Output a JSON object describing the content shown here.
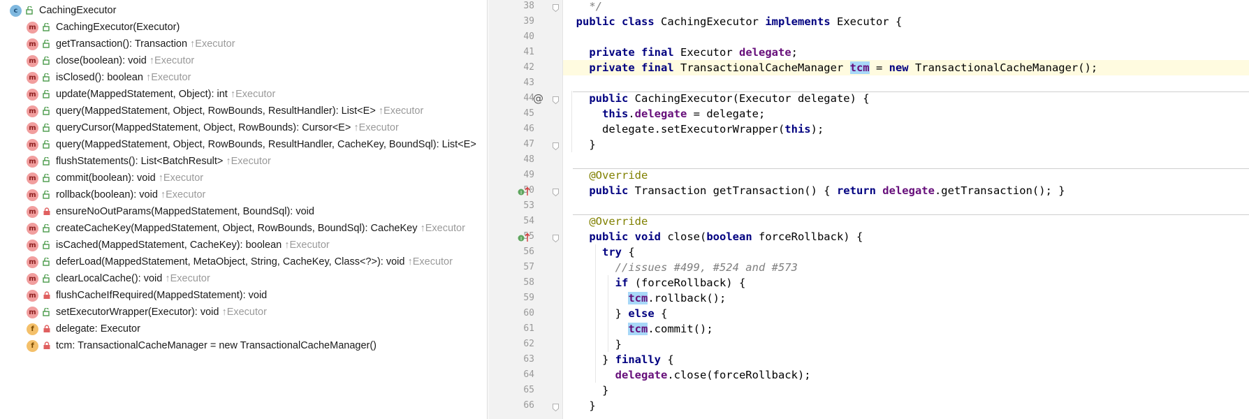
{
  "structure": {
    "root": {
      "label": "CachingExecutor",
      "badge": "c"
    },
    "items": [
      {
        "badge": "m",
        "vis": "public",
        "label": "CachingExecutor(Executor)",
        "inherit": ""
      },
      {
        "badge": "m",
        "vis": "public",
        "label": "getTransaction(): Transaction",
        "inherit": "↑Executor"
      },
      {
        "badge": "m",
        "vis": "public",
        "label": "close(boolean): void",
        "inherit": "↑Executor"
      },
      {
        "badge": "m",
        "vis": "public",
        "label": "isClosed(): boolean",
        "inherit": "↑Executor"
      },
      {
        "badge": "m",
        "vis": "public",
        "label": "update(MappedStatement, Object): int",
        "inherit": "↑Executor"
      },
      {
        "badge": "m",
        "vis": "public",
        "label": "query(MappedStatement, Object, RowBounds, ResultHandler): List<E>",
        "inherit": "↑Executor"
      },
      {
        "badge": "m",
        "vis": "public",
        "label": "queryCursor(MappedStatement, Object, RowBounds): Cursor<E>",
        "inherit": "↑Executor"
      },
      {
        "badge": "m",
        "vis": "public",
        "label": "query(MappedStatement, Object, RowBounds, ResultHandler, CacheKey, BoundSql): List<E>",
        "inherit": ""
      },
      {
        "badge": "m",
        "vis": "public",
        "label": "flushStatements(): List<BatchResult>",
        "inherit": "↑Executor"
      },
      {
        "badge": "m",
        "vis": "public",
        "label": "commit(boolean): void",
        "inherit": "↑Executor"
      },
      {
        "badge": "m",
        "vis": "public",
        "label": "rollback(boolean): void",
        "inherit": "↑Executor"
      },
      {
        "badge": "m",
        "vis": "private",
        "label": "ensureNoOutParams(MappedStatement, BoundSql): void",
        "inherit": ""
      },
      {
        "badge": "m",
        "vis": "public",
        "label": "createCacheKey(MappedStatement, Object, RowBounds, BoundSql): CacheKey",
        "inherit": "↑Executor"
      },
      {
        "badge": "m",
        "vis": "public",
        "label": "isCached(MappedStatement, CacheKey): boolean",
        "inherit": "↑Executor"
      },
      {
        "badge": "m",
        "vis": "public",
        "label": "deferLoad(MappedStatement, MetaObject, String, CacheKey, Class<?>): void",
        "inherit": "↑Executor"
      },
      {
        "badge": "m",
        "vis": "public",
        "label": "clearLocalCache(): void",
        "inherit": "↑Executor"
      },
      {
        "badge": "m",
        "vis": "private",
        "label": "flushCacheIfRequired(MappedStatement): void",
        "inherit": ""
      },
      {
        "badge": "m",
        "vis": "public",
        "label": "setExecutorWrapper(Executor): void",
        "inherit": "↑Executor"
      },
      {
        "badge": "f",
        "vis": "private",
        "label": "delegate: Executor",
        "inherit": ""
      },
      {
        "badge": "f",
        "vis": "private",
        "label": "tcm: TransactionalCacheManager = new TransactionalCacheManager()",
        "inherit": ""
      }
    ]
  },
  "editor": {
    "gutter_marks": {
      "at_sign": "@"
    },
    "lines": [
      {
        "n": "38",
        "text": "*/"
      },
      {
        "n": "39",
        "text": "public class CachingExecutor implements Executor {"
      },
      {
        "n": "40",
        "text": ""
      },
      {
        "n": "41",
        "text": "private final Executor delegate;"
      },
      {
        "n": "42",
        "text": "private final TransactionalCacheManager tcm = new TransactionalCacheManager();"
      },
      {
        "n": "43",
        "text": ""
      },
      {
        "n": "44",
        "text": "public CachingExecutor(Executor delegate) {"
      },
      {
        "n": "45",
        "text": "this.delegate = delegate;"
      },
      {
        "n": "46",
        "text": "delegate.setExecutorWrapper(this);"
      },
      {
        "n": "47",
        "text": "}"
      },
      {
        "n": "48",
        "text": ""
      },
      {
        "n": "49",
        "text": "@Override"
      },
      {
        "n": "50",
        "text": "public Transaction getTransaction() { return delegate.getTransaction(); }"
      },
      {
        "n": "53",
        "text": ""
      },
      {
        "n": "54",
        "text": "@Override"
      },
      {
        "n": "55",
        "text": "public void close(boolean forceRollback) {"
      },
      {
        "n": "56",
        "text": "try {"
      },
      {
        "n": "57",
        "text": "//issues #499, #524 and #573"
      },
      {
        "n": "58",
        "text": "if (forceRollback) {"
      },
      {
        "n": "59",
        "text": "tcm.rollback();"
      },
      {
        "n": "60",
        "text": "} else {"
      },
      {
        "n": "61",
        "text": "tcm.commit();"
      },
      {
        "n": "62",
        "text": "}"
      },
      {
        "n": "63",
        "text": "} finally {"
      },
      {
        "n": "64",
        "text": "delegate.close(forceRollback);"
      },
      {
        "n": "65",
        "text": "}"
      },
      {
        "n": "66",
        "text": "}"
      }
    ]
  }
}
